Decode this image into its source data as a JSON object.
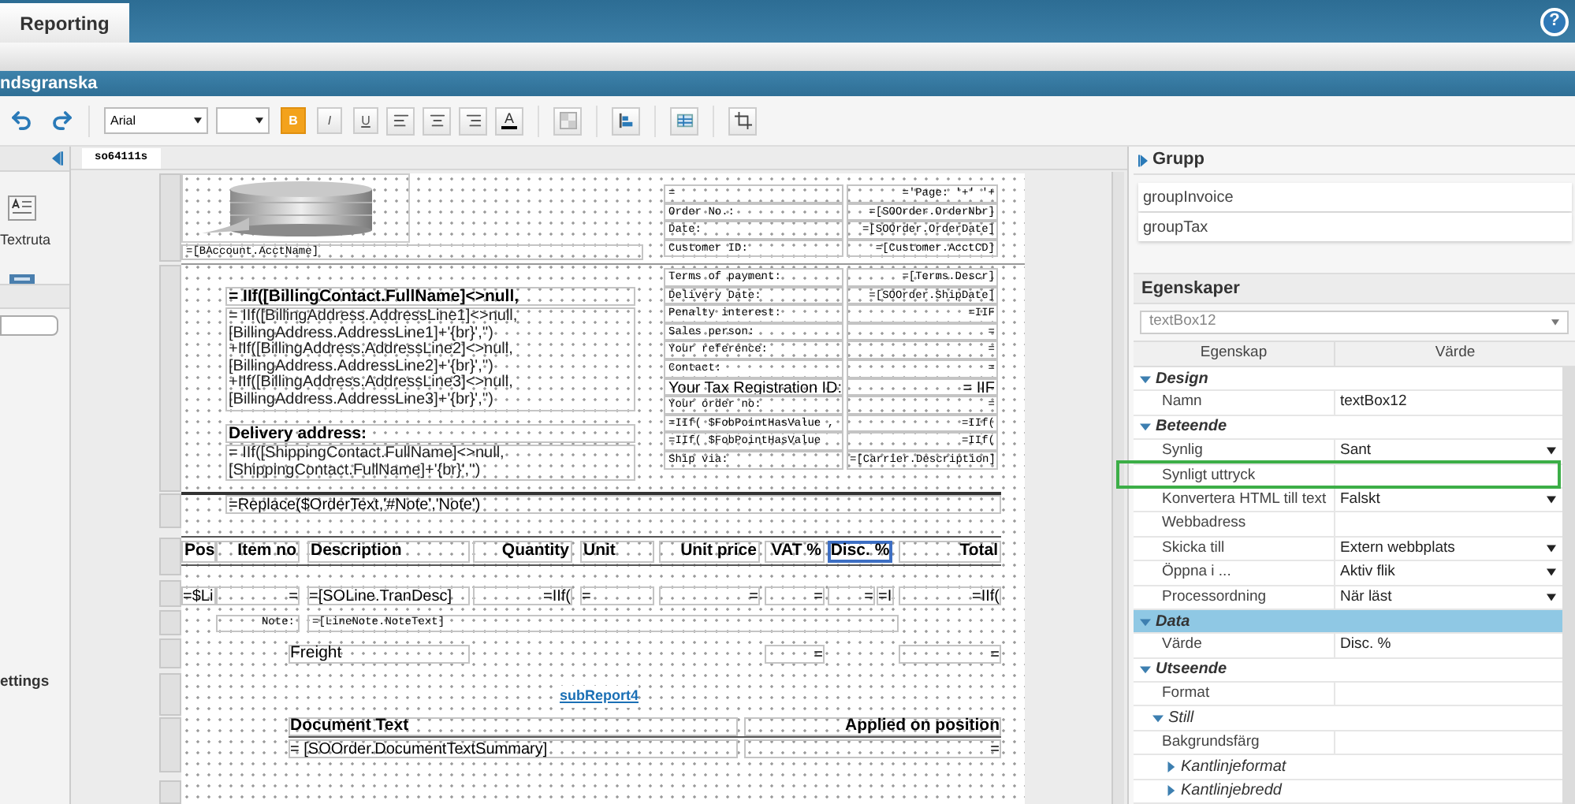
{
  "app_tab": {
    "label": "Reporting",
    "selected": true
  },
  "help_button": "?",
  "title_bar": "ndsgranska",
  "toolbar": {
    "font": "Arial",
    "format_buttons": [
      {
        "label": "B",
        "active": true
      },
      {
        "label": "I",
        "active": false
      },
      {
        "label": "U",
        "active": false
      }
    ],
    "font_color": "A"
  },
  "left_panel": {
    "tool": "Textruta",
    "section": "ettings"
  },
  "document_tab": {
    "label": "so64111s",
    "selected": true
  },
  "report": {
    "account_name": "=[BAccount.AcctName]",
    "header_rows": [
      {
        "label": "=",
        "value": "='Page: '+' '+"
      },
      {
        "label": "Order No.:",
        "value": "=[SOOrder.OrderNbr]"
      },
      {
        "label": "Date:",
        "value": "=[SOOrder.OrderDate]"
      },
      {
        "label": "Customer ID:",
        "value": "=[Customer.AcctCD]"
      }
    ],
    "info_rows": [
      {
        "kind": "code",
        "label": "Terms of payment:",
        "value": "=[Terms.Descr]"
      },
      {
        "kind": "code",
        "label": "Delivery Date:",
        "value": "=[SOOrder.ShipDate]"
      },
      {
        "kind": "code",
        "label": "Penalty interest:",
        "value": "=IIF"
      },
      {
        "kind": "code",
        "label": "Sales person:",
        "value": "="
      },
      {
        "kind": "code",
        "label": "Your reference:",
        "value": "="
      },
      {
        "kind": "code",
        "label": "Contact:",
        "value": "="
      },
      {
        "kind": "large",
        "label": "Your Tax Registration ID:",
        "value": "= IIF"
      },
      {
        "kind": "code",
        "label": "Your order no:",
        "value": "="
      },
      {
        "kind": "code",
        "label": "=IIf( $FobPointHasValue ,",
        "value": "=IIf("
      },
      {
        "kind": "code",
        "label": "=IIf( $FobPointHasValue",
        "value": "=IIf("
      },
      {
        "kind": "code",
        "label": "Ship via:",
        "value": "=[Carrier.Description]"
      }
    ],
    "billing": {
      "title": "= IIf([BillingContact.FullName]<>null,",
      "lines": [
        "= IIf([BillingAddress.AddressLine1]<>null,",
        "[BillingAddress.AddressLine1]+'{br}','')",
        "+IIf([BillingAddress.AddressLine2]<>null,",
        "[BillingAddress.AddressLine2]+'{br}','')",
        "+IIf([BillingAddress.AddressLine3]<>null,",
        "[BillingAddress.AddressLine3]+'{br}','')"
      ]
    },
    "delivery": {
      "title": "Delivery address:",
      "lines": [
        "= IIf([ShippingContact.FullName]<>null,",
        "[ShippingContact.FullName]+'{br}','')"
      ]
    },
    "order_text": "=Replace($OrderText,'#Note','Note')",
    "columns": [
      {
        "label": "Pos",
        "selected": false
      },
      {
        "label": "Item no",
        "selected": false
      },
      {
        "label": "Description",
        "selected": false
      },
      {
        "label": "Quantity",
        "selected": false
      },
      {
        "label": "Unit",
        "selected": false
      },
      {
        "label": "Unit price",
        "selected": false
      },
      {
        "label": "VAT %",
        "selected": false
      },
      {
        "label": "Disc. %",
        "selected": true
      },
      {
        "label": "Total",
        "selected": false
      }
    ],
    "detail_cells": [
      "=$Li",
      "=",
      "=[SOLine.TranDesc]",
      "=IIf(",
      "=",
      "=",
      "=",
      "=",
      "=I",
      "=IIf("
    ],
    "note": {
      "label": "Note:",
      "value": "=[LineNote.NoteText]"
    },
    "freight": {
      "label": "Freight",
      "values": [
        "=",
        "="
      ]
    },
    "subreport": "subReport4",
    "document_text": {
      "columns": [
        "Document Text",
        "Applied on position"
      ],
      "values": [
        "= [SOOrder.DocumentTextSummary]",
        "="
      ]
    }
  },
  "groups": {
    "title": "Grupp",
    "items": [
      "groupInvoice",
      "groupTax"
    ]
  },
  "properties": {
    "title": "Egenskaper",
    "object": "textBox12",
    "columns": [
      "Egenskap",
      "Värde"
    ],
    "rows": [
      {
        "label": "Design",
        "expanded": true,
        "selected": false,
        "children": [
          {
            "label": "Namn",
            "value": "textBox12",
            "dropdown": false,
            "selected": false
          }
        ]
      },
      {
        "label": "Beteende",
        "expanded": true,
        "selected": false,
        "children": [
          {
            "label": "Synlig",
            "value": "Sant",
            "dropdown": true,
            "selected": false
          },
          {
            "label": "Synligt uttryck",
            "dropdown": false,
            "selected": false
          },
          {
            "label": "Konvertera HTML till text",
            "value": "Falskt",
            "dropdown": true,
            "selected": false
          },
          {
            "label": "Webbadress",
            "dropdown": false,
            "selected": false
          },
          {
            "label": "Skicka till",
            "value": "Extern webbplats",
            "dropdown": true,
            "selected": false
          },
          {
            "label": "Öppna i ...",
            "value": "Aktiv flik",
            "dropdown": true,
            "selected": false
          },
          {
            "label": "Processordning",
            "value": "När läst",
            "dropdown": true,
            "selected": false
          }
        ]
      },
      {
        "label": "Data",
        "expanded": true,
        "selected": true,
        "children": [
          {
            "label": "Värde",
            "value": "Disc. %",
            "dropdown": false,
            "selected": false
          }
        ]
      },
      {
        "label": "Utseende",
        "expanded": true,
        "selected": false,
        "children": [
          {
            "label": "Format",
            "dropdown": false,
            "selected": false
          },
          {
            "label": "Still",
            "expanded": true,
            "selected": false,
            "children": [
              {
                "label": "Bakgrundsfärg",
                "dropdown": false,
                "selected": false
              },
              {
                "label": "Kantlinjeformat",
                "expanded": false,
                "selected": false
              },
              {
                "label": "Kantlinjebredd",
                "expanded": false,
                "selected": false
              }
            ]
          }
        ]
      }
    ]
  }
}
